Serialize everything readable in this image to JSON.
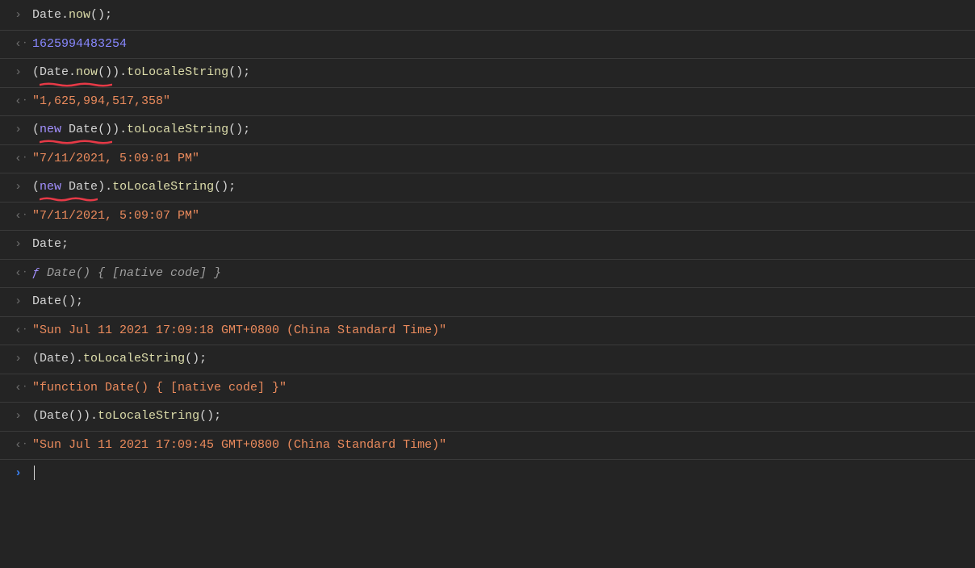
{
  "console": {
    "entries": [
      {
        "input": {
          "tokens": [
            {
              "t": "Date",
              "c": "c-default"
            },
            {
              "t": ".",
              "c": "c-punc"
            },
            {
              "t": "now",
              "c": "c-prop"
            },
            {
              "t": "();",
              "c": "c-punc"
            }
          ],
          "underline": null
        },
        "output": {
          "tokens": [
            {
              "t": "1625994483254",
              "c": "c-num"
            }
          ]
        }
      },
      {
        "input": {
          "tokens": [
            {
              "t": "(",
              "c": "c-punc"
            },
            {
              "t": "Date",
              "c": "c-default",
              "ul_start": true
            },
            {
              "t": ".",
              "c": "c-punc"
            },
            {
              "t": "now",
              "c": "c-prop"
            },
            {
              "t": "()",
              "c": "c-punc",
              "ul_end": true
            },
            {
              "t": ").",
              "c": "c-punc"
            },
            {
              "t": "toLocaleString",
              "c": "c-prop"
            },
            {
              "t": "();",
              "c": "c-punc"
            }
          ]
        },
        "output": {
          "tokens": [
            {
              "t": "\"1,625,994,517,358\"",
              "c": "c-str"
            }
          ]
        }
      },
      {
        "input": {
          "tokens": [
            {
              "t": "(",
              "c": "c-punc"
            },
            {
              "t": "new",
              "c": "c-keyword",
              "ul_start": true
            },
            {
              "t": " ",
              "c": "c-punc"
            },
            {
              "t": "Date",
              "c": "c-default"
            },
            {
              "t": "()",
              "c": "c-punc",
              "ul_end": true
            },
            {
              "t": ").",
              "c": "c-punc"
            },
            {
              "t": "toLocaleString",
              "c": "c-prop"
            },
            {
              "t": "();",
              "c": "c-punc"
            }
          ]
        },
        "output": {
          "tokens": [
            {
              "t": "\"7/11/2021, 5:09:01 PM\"",
              "c": "c-str"
            }
          ]
        }
      },
      {
        "input": {
          "tokens": [
            {
              "t": "(",
              "c": "c-punc"
            },
            {
              "t": "new",
              "c": "c-keyword",
              "ul_start": true
            },
            {
              "t": " ",
              "c": "c-punc"
            },
            {
              "t": "Date",
              "c": "c-default",
              "ul_end": true
            },
            {
              "t": ").",
              "c": "c-punc"
            },
            {
              "t": "toLocaleString",
              "c": "c-prop"
            },
            {
              "t": "();",
              "c": "c-punc"
            }
          ]
        },
        "output": {
          "tokens": [
            {
              "t": "\"7/11/2021, 5:09:07 PM\"",
              "c": "c-str"
            }
          ]
        }
      },
      {
        "input": {
          "tokens": [
            {
              "t": "Date",
              "c": "c-default"
            },
            {
              "t": ";",
              "c": "c-punc"
            }
          ]
        },
        "output": {
          "tokens": [
            {
              "t": "ƒ ",
              "c": "c-func"
            },
            {
              "t": "Date() { [native code] }",
              "c": "c-funcbody"
            }
          ]
        }
      },
      {
        "input": {
          "tokens": [
            {
              "t": "Date",
              "c": "c-default"
            },
            {
              "t": "();",
              "c": "c-punc"
            }
          ]
        },
        "output": {
          "tokens": [
            {
              "t": "\"Sun Jul 11 2021 17:09:18 GMT+0800 (China Standard Time)\"",
              "c": "c-str"
            }
          ]
        }
      },
      {
        "input": {
          "tokens": [
            {
              "t": "(",
              "c": "c-punc"
            },
            {
              "t": "Date",
              "c": "c-default"
            },
            {
              "t": ").",
              "c": "c-punc"
            },
            {
              "t": "toLocaleString",
              "c": "c-prop"
            },
            {
              "t": "();",
              "c": "c-punc"
            }
          ]
        },
        "output": {
          "tokens": [
            {
              "t": "\"function Date() { [native code] }\"",
              "c": "c-str"
            }
          ]
        }
      },
      {
        "input": {
          "tokens": [
            {
              "t": "(",
              "c": "c-punc"
            },
            {
              "t": "Date",
              "c": "c-default"
            },
            {
              "t": "()).",
              "c": "c-punc"
            },
            {
              "t": "toLocaleString",
              "c": "c-prop"
            },
            {
              "t": "();",
              "c": "c-punc"
            }
          ]
        },
        "output": {
          "tokens": [
            {
              "t": "\"Sun Jul 11 2021 17:09:45 GMT+0800 (China Standard Time)\"",
              "c": "c-str"
            }
          ]
        }
      }
    ],
    "annotation_color": "#e63946"
  }
}
